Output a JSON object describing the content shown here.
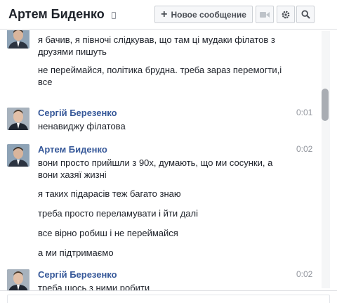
{
  "header": {
    "title": "Артем Биденко",
    "status_icon": "mobile-device-icon",
    "new_message_label": "Новое сообщение",
    "icons": [
      "plus-icon",
      "video-call-icon",
      "gear-icon",
      "search-icon"
    ]
  },
  "messages": [
    {
      "author": "",
      "time": "",
      "lines": [
        "я бачив, я півночі слідкував, що там ці мудаки філатов з друзями пишуть",
        "не переймайся, політика брудна. треба зараз перемогти,і все"
      ]
    },
    {
      "author": "Сергій Березенко",
      "time": "0:01",
      "lines": [
        "ненавиджу філатова"
      ]
    },
    {
      "author": "Артем Биденко",
      "time": "0:02",
      "lines": [
        "вони просто прийшли з 90х, думають, що ми сосунки, а вони хазяї жизні",
        "я таких підарасів теж багато знаю",
        "треба просто переламувати і йти далі",
        "все вірно робиш і не переймайся",
        "а ми підтримаємо"
      ]
    },
    {
      "author": "Сергій Березенко",
      "time": "0:02",
      "lines": [
        "треба щось з ними робити"
      ]
    }
  ],
  "colors": {
    "author_link": "#365899",
    "text": "#1d2129",
    "timestamp": "#90949c",
    "border": "#dddfe2"
  }
}
